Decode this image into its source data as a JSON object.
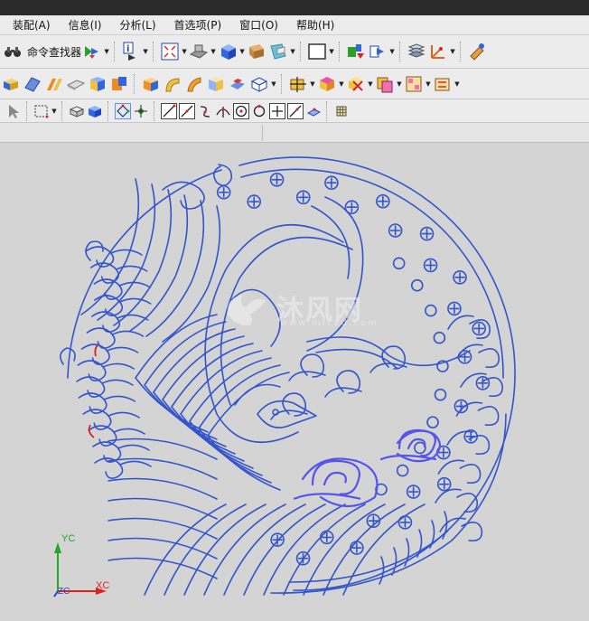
{
  "menu": {
    "items": [
      "装配(A)",
      "信息(I)",
      "分析(L)",
      "首选项(P)",
      "窗口(O)",
      "帮助(H)"
    ]
  },
  "toolbar": {
    "command_finder_label": "命令查找器"
  },
  "viewport": {
    "watermark_text": "沐风网",
    "watermark_url": "www.mfcad.com"
  },
  "triad": {
    "x_label": "XC",
    "y_label": "YC",
    "z_label": "ZC"
  },
  "colors": {
    "curve_blue": "#3355cc",
    "highlight_blue": "#5555ee",
    "selection_red": "#dd2222",
    "x_axis": "#dd2222",
    "y_axis": "#22aa22",
    "z_axis": "#2244cc"
  }
}
